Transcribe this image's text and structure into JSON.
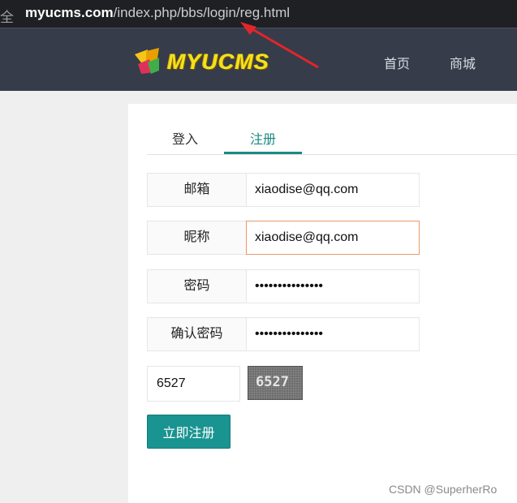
{
  "addressbar": {
    "secure_label": "全",
    "url_host": "myucms.com",
    "url_path": "/index.php/bbs/login/reg.html"
  },
  "header": {
    "logo_text": "MYUCMS",
    "nav": [
      "首页",
      "商城"
    ]
  },
  "tabs": {
    "login": "登入",
    "register": "注册",
    "active": "register"
  },
  "form": {
    "fields": [
      {
        "label": "邮箱",
        "value": "xiaodise@qq.com"
      },
      {
        "label": "昵称",
        "value": "xiaodise@qq.com"
      },
      {
        "label": "密码",
        "value": "•••••••••••••••"
      },
      {
        "label": "确认密码",
        "value": "•••••••••••••••"
      }
    ],
    "captcha_value": "6527",
    "captcha_image_text": "6527",
    "submit_label": "立即注册"
  },
  "watermark": "CSDN @SuperherRo",
  "colors": {
    "accent": "#1a8a82",
    "button": "#1a9491",
    "header_bg": "#363c4a",
    "arrow": "#e0262b",
    "logo_text": "#f2e21c"
  }
}
